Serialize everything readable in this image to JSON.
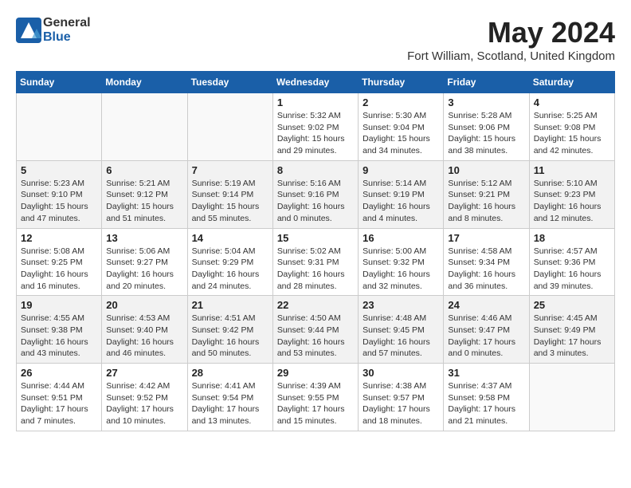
{
  "logo": {
    "general": "General",
    "blue": "Blue"
  },
  "title": "May 2024",
  "location": "Fort William, Scotland, United Kingdom",
  "days_of_week": [
    "Sunday",
    "Monday",
    "Tuesday",
    "Wednesday",
    "Thursday",
    "Friday",
    "Saturday"
  ],
  "weeks": [
    [
      {
        "num": "",
        "info": ""
      },
      {
        "num": "",
        "info": ""
      },
      {
        "num": "",
        "info": ""
      },
      {
        "num": "1",
        "info": "Sunrise: 5:32 AM\nSunset: 9:02 PM\nDaylight: 15 hours\nand 29 minutes."
      },
      {
        "num": "2",
        "info": "Sunrise: 5:30 AM\nSunset: 9:04 PM\nDaylight: 15 hours\nand 34 minutes."
      },
      {
        "num": "3",
        "info": "Sunrise: 5:28 AM\nSunset: 9:06 PM\nDaylight: 15 hours\nand 38 minutes."
      },
      {
        "num": "4",
        "info": "Sunrise: 5:25 AM\nSunset: 9:08 PM\nDaylight: 15 hours\nand 42 minutes."
      }
    ],
    [
      {
        "num": "5",
        "info": "Sunrise: 5:23 AM\nSunset: 9:10 PM\nDaylight: 15 hours\nand 47 minutes."
      },
      {
        "num": "6",
        "info": "Sunrise: 5:21 AM\nSunset: 9:12 PM\nDaylight: 15 hours\nand 51 minutes."
      },
      {
        "num": "7",
        "info": "Sunrise: 5:19 AM\nSunset: 9:14 PM\nDaylight: 15 hours\nand 55 minutes."
      },
      {
        "num": "8",
        "info": "Sunrise: 5:16 AM\nSunset: 9:16 PM\nDaylight: 16 hours\nand 0 minutes."
      },
      {
        "num": "9",
        "info": "Sunrise: 5:14 AM\nSunset: 9:19 PM\nDaylight: 16 hours\nand 4 minutes."
      },
      {
        "num": "10",
        "info": "Sunrise: 5:12 AM\nSunset: 9:21 PM\nDaylight: 16 hours\nand 8 minutes."
      },
      {
        "num": "11",
        "info": "Sunrise: 5:10 AM\nSunset: 9:23 PM\nDaylight: 16 hours\nand 12 minutes."
      }
    ],
    [
      {
        "num": "12",
        "info": "Sunrise: 5:08 AM\nSunset: 9:25 PM\nDaylight: 16 hours\nand 16 minutes."
      },
      {
        "num": "13",
        "info": "Sunrise: 5:06 AM\nSunset: 9:27 PM\nDaylight: 16 hours\nand 20 minutes."
      },
      {
        "num": "14",
        "info": "Sunrise: 5:04 AM\nSunset: 9:29 PM\nDaylight: 16 hours\nand 24 minutes."
      },
      {
        "num": "15",
        "info": "Sunrise: 5:02 AM\nSunset: 9:31 PM\nDaylight: 16 hours\nand 28 minutes."
      },
      {
        "num": "16",
        "info": "Sunrise: 5:00 AM\nSunset: 9:32 PM\nDaylight: 16 hours\nand 32 minutes."
      },
      {
        "num": "17",
        "info": "Sunrise: 4:58 AM\nSunset: 9:34 PM\nDaylight: 16 hours\nand 36 minutes."
      },
      {
        "num": "18",
        "info": "Sunrise: 4:57 AM\nSunset: 9:36 PM\nDaylight: 16 hours\nand 39 minutes."
      }
    ],
    [
      {
        "num": "19",
        "info": "Sunrise: 4:55 AM\nSunset: 9:38 PM\nDaylight: 16 hours\nand 43 minutes."
      },
      {
        "num": "20",
        "info": "Sunrise: 4:53 AM\nSunset: 9:40 PM\nDaylight: 16 hours\nand 46 minutes."
      },
      {
        "num": "21",
        "info": "Sunrise: 4:51 AM\nSunset: 9:42 PM\nDaylight: 16 hours\nand 50 minutes."
      },
      {
        "num": "22",
        "info": "Sunrise: 4:50 AM\nSunset: 9:44 PM\nDaylight: 16 hours\nand 53 minutes."
      },
      {
        "num": "23",
        "info": "Sunrise: 4:48 AM\nSunset: 9:45 PM\nDaylight: 16 hours\nand 57 minutes."
      },
      {
        "num": "24",
        "info": "Sunrise: 4:46 AM\nSunset: 9:47 PM\nDaylight: 17 hours\nand 0 minutes."
      },
      {
        "num": "25",
        "info": "Sunrise: 4:45 AM\nSunset: 9:49 PM\nDaylight: 17 hours\nand 3 minutes."
      }
    ],
    [
      {
        "num": "26",
        "info": "Sunrise: 4:44 AM\nSunset: 9:51 PM\nDaylight: 17 hours\nand 7 minutes."
      },
      {
        "num": "27",
        "info": "Sunrise: 4:42 AM\nSunset: 9:52 PM\nDaylight: 17 hours\nand 10 minutes."
      },
      {
        "num": "28",
        "info": "Sunrise: 4:41 AM\nSunset: 9:54 PM\nDaylight: 17 hours\nand 13 minutes."
      },
      {
        "num": "29",
        "info": "Sunrise: 4:39 AM\nSunset: 9:55 PM\nDaylight: 17 hours\nand 15 minutes."
      },
      {
        "num": "30",
        "info": "Sunrise: 4:38 AM\nSunset: 9:57 PM\nDaylight: 17 hours\nand 18 minutes."
      },
      {
        "num": "31",
        "info": "Sunrise: 4:37 AM\nSunset: 9:58 PM\nDaylight: 17 hours\nand 21 minutes."
      },
      {
        "num": "",
        "info": ""
      }
    ]
  ]
}
